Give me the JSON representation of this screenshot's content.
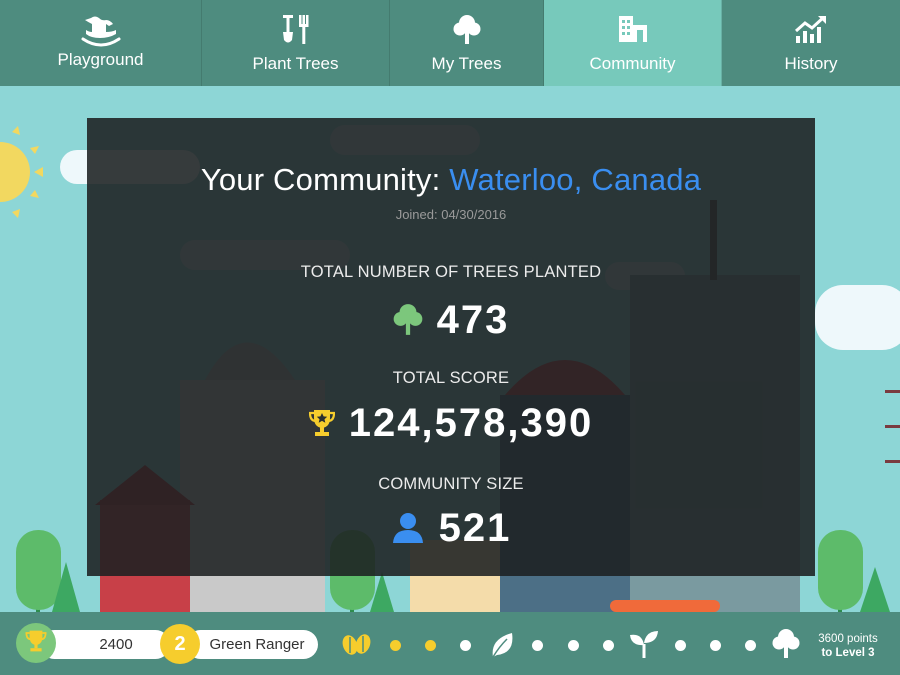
{
  "nav": {
    "tabs": [
      {
        "label": "Playground",
        "icon": "rocking-horse-icon"
      },
      {
        "label": "Plant Trees",
        "icon": "garden-tools-icon"
      },
      {
        "label": "My Trees",
        "icon": "tree-icon"
      },
      {
        "label": "Community",
        "icon": "buildings-icon"
      },
      {
        "label": "History",
        "icon": "trend-chart-icon"
      }
    ],
    "active_tab": "Community"
  },
  "community": {
    "title_prefix": "Your Community: ",
    "location": "Waterloo, Canada",
    "joined": "Joined: 04/30/2016",
    "stats": [
      {
        "label": "TOTAL NUMBER OF TREES PLANTED",
        "value": "473",
        "icon": "tree-icon"
      },
      {
        "label": "TOTAL SCORE",
        "value": "124,578,390",
        "icon": "trophy-icon"
      },
      {
        "label": "COMMUNITY SIZE",
        "value": "521",
        "icon": "person-icon"
      }
    ]
  },
  "footer": {
    "score": "2400",
    "level_number": "2",
    "rank": "Green Ranger",
    "progress_points": "3600 points",
    "progress_target": "to Level 3",
    "milestone_icons": [
      "seeds-icon",
      "leaf-icon",
      "sprout-icon",
      "tree-icon"
    ],
    "filled_dots": 2
  },
  "colors": {
    "nav_bg": "#4e8c7f",
    "nav_active": "#77c9bb",
    "sky": "#8dd6d6",
    "accent_blue": "#3a8ef0",
    "gold": "#f6cd2d",
    "green": "#7cc77c"
  }
}
